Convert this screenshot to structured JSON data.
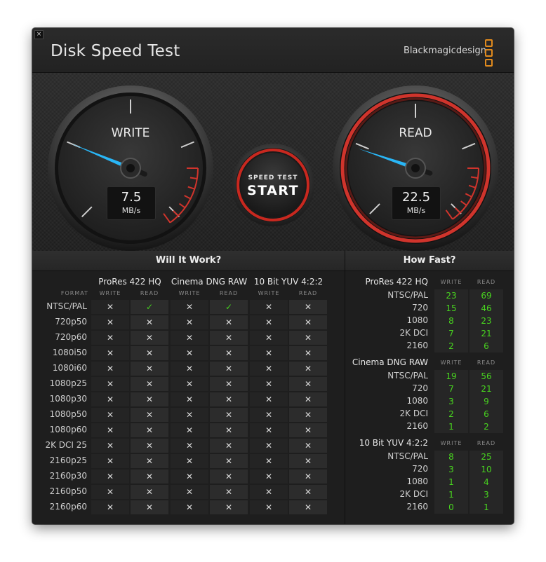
{
  "window": {
    "title": "Disk Speed Test",
    "brand": "Blackmagicdesign",
    "close_label": "×"
  },
  "gauges": {
    "write": {
      "label": "WRITE",
      "value": "7.5",
      "unit": "MB/s",
      "needle_value": 7.5
    },
    "read": {
      "label": "READ",
      "value": "22.5",
      "unit": "MB/s",
      "needle_value": 22.5
    }
  },
  "start_button": {
    "top": "SPEED TEST",
    "main": "START"
  },
  "settings_icon": "gear-icon",
  "will_it_work": {
    "title": "Will It Work?",
    "format_header": "FORMAT",
    "codecs": [
      "ProRes 422 HQ",
      "Cinema DNG RAW",
      "10 Bit YUV 4:2:2"
    ],
    "write_label": "WRITE",
    "read_label": "READ",
    "formats": [
      "NTSC/PAL",
      "720p50",
      "720p60",
      "1080i50",
      "1080i60",
      "1080p25",
      "1080p30",
      "1080p50",
      "1080p60",
      "2K DCI 25",
      "2160p25",
      "2160p30",
      "2160p50",
      "2160p60"
    ],
    "results": [
      [
        "✕",
        "✓",
        "✕",
        "✓",
        "✕",
        "✕"
      ],
      [
        "✕",
        "✕",
        "✕",
        "✕",
        "✕",
        "✕"
      ],
      [
        "✕",
        "✕",
        "✕",
        "✕",
        "✕",
        "✕"
      ],
      [
        "✕",
        "✕",
        "✕",
        "✕",
        "✕",
        "✕"
      ],
      [
        "✕",
        "✕",
        "✕",
        "✕",
        "✕",
        "✕"
      ],
      [
        "✕",
        "✕",
        "✕",
        "✕",
        "✕",
        "✕"
      ],
      [
        "✕",
        "✕",
        "✕",
        "✕",
        "✕",
        "✕"
      ],
      [
        "✕",
        "✕",
        "✕",
        "✕",
        "✕",
        "✕"
      ],
      [
        "✕",
        "✕",
        "✕",
        "✕",
        "✕",
        "✕"
      ],
      [
        "✕",
        "✕",
        "✕",
        "✕",
        "✕",
        "✕"
      ],
      [
        "✕",
        "✕",
        "✕",
        "✕",
        "✕",
        "✕"
      ],
      [
        "✕",
        "✕",
        "✕",
        "✕",
        "✕",
        "✕"
      ],
      [
        "✕",
        "✕",
        "✕",
        "✕",
        "✕",
        "✕"
      ],
      [
        "✕",
        "✕",
        "✕",
        "✕",
        "✕",
        "✕"
      ]
    ]
  },
  "how_fast": {
    "title": "How Fast?",
    "write_label": "WRITE",
    "read_label": "READ",
    "groups": [
      {
        "name": "ProRes 422 HQ",
        "rows": [
          {
            "format": "NTSC/PAL",
            "write": "23",
            "read": "69"
          },
          {
            "format": "720",
            "write": "15",
            "read": "46"
          },
          {
            "format": "1080",
            "write": "8",
            "read": "23"
          },
          {
            "format": "2K DCI",
            "write": "7",
            "read": "21"
          },
          {
            "format": "2160",
            "write": "2",
            "read": "6"
          }
        ]
      },
      {
        "name": "Cinema DNG RAW",
        "rows": [
          {
            "format": "NTSC/PAL",
            "write": "19",
            "read": "56"
          },
          {
            "format": "720",
            "write": "7",
            "read": "21"
          },
          {
            "format": "1080",
            "write": "3",
            "read": "9"
          },
          {
            "format": "2K DCI",
            "write": "2",
            "read": "6"
          },
          {
            "format": "2160",
            "write": "1",
            "read": "2"
          }
        ]
      },
      {
        "name": "10 Bit YUV 4:2:2",
        "rows": [
          {
            "format": "NTSC/PAL",
            "write": "8",
            "read": "25"
          },
          {
            "format": "720",
            "write": "3",
            "read": "10"
          },
          {
            "format": "1080",
            "write": "1",
            "read": "4"
          },
          {
            "format": "2K DCI",
            "write": "1",
            "read": "3"
          },
          {
            "format": "2160",
            "write": "0",
            "read": "1"
          }
        ]
      }
    ]
  },
  "colors": {
    "accent_blue": "#29b6f6",
    "red_zone": "#d0342c",
    "ok_green": "#45d21f",
    "value_green": "#48d41f",
    "brand_orange": "#e08a1e"
  }
}
